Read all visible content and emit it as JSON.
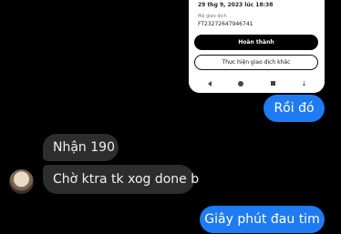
{
  "embedded_screenshot": {
    "datetime": "29 thg 9, 2023 lúc 18:38",
    "code_label": "Mã giao dịch",
    "code": "FT23272647946741",
    "primary_button": "Hoàn thành",
    "secondary_button": "Thực hiện giao dịch khác"
  },
  "messages": [
    {
      "direction": "outgoing",
      "text": "Rồi đó"
    },
    {
      "direction": "incoming",
      "text": "Nhận 190"
    },
    {
      "direction": "incoming",
      "text": "Chờ ktra tk xog done b"
    },
    {
      "direction": "outgoing",
      "text": "Giây phút đau tim"
    }
  ],
  "colors": {
    "background": "#000000",
    "outgoing_bubble": "#1f7bf2",
    "incoming_bubble": "#2d2d2d"
  }
}
